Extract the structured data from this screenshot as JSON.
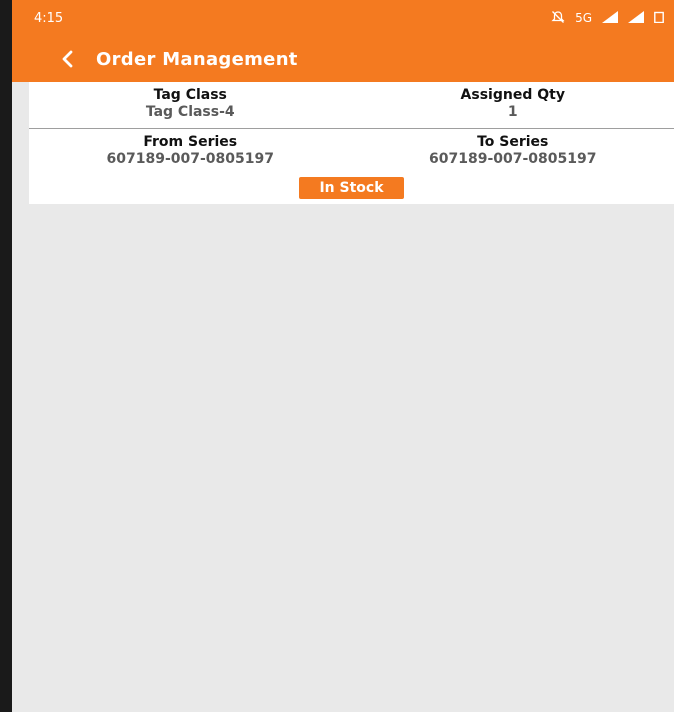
{
  "status_bar": {
    "time": "4:15",
    "network": "5G"
  },
  "app_bar": {
    "title": "Order Management"
  },
  "order_card": {
    "tag_class_label": "Tag Class",
    "tag_class_value": "Tag Class-4",
    "assigned_qty_label": "Assigned Qty",
    "assigned_qty_value": "1",
    "from_series_label": "From Series",
    "from_series_value": "607189-007-0805197",
    "to_series_label": "To Series",
    "to_series_value": "607189-007-0805197",
    "status": "In Stock"
  },
  "colors": {
    "accent": "#f47a20",
    "background": "#e9e9e9",
    "card": "#ffffff"
  },
  "icons": [
    "back-arrow-icon",
    "mute-icon",
    "signal-icon",
    "battery-icon"
  ]
}
